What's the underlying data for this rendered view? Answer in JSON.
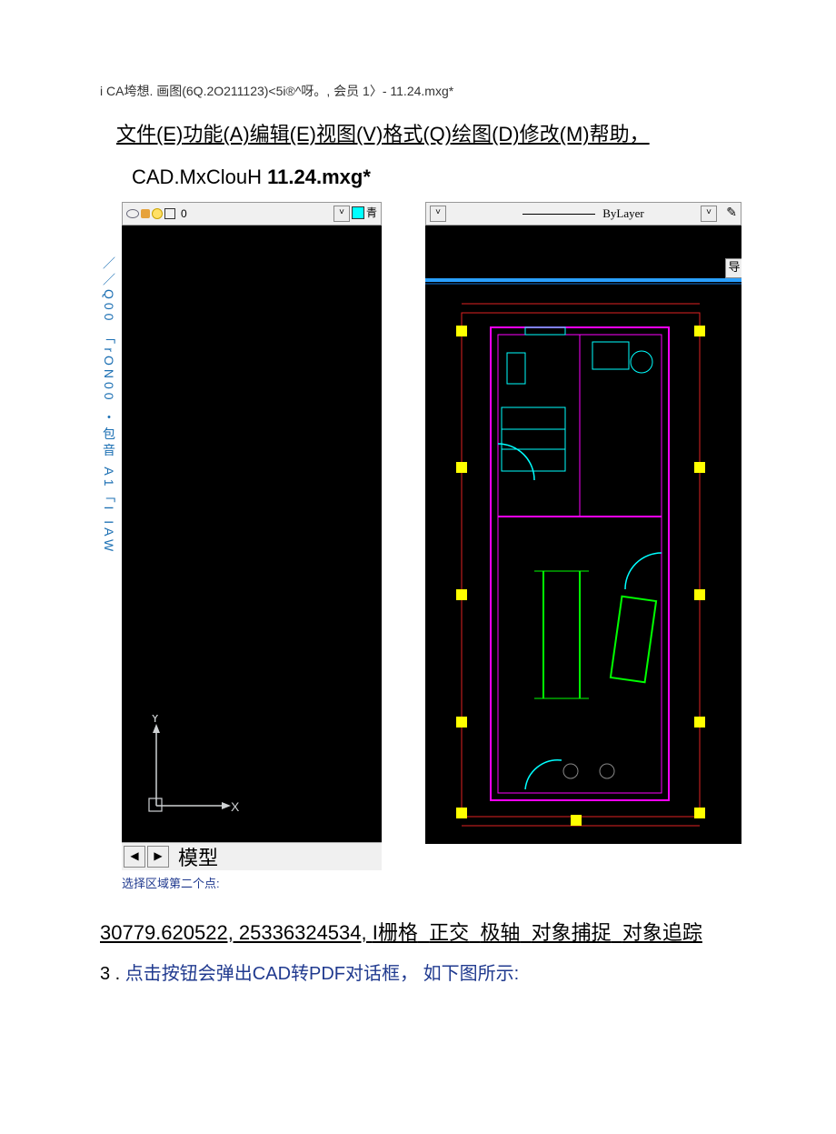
{
  "topTitle": "i CA垮想. 画图(6Q.2O211123)<5i®^呀。, 会员 1〉- 11.24.mxg*",
  "menu": {
    "file": "文件(E)",
    "feature": "功能(A)",
    "edit": "编辑(E)",
    "view": "视图(V)",
    "format": "格式(Q)",
    "draw": "绘图(D)",
    "modify": "修改(M)",
    "help": "帮助，"
  },
  "fileTitlePrefix": "CAD.MxClouH ",
  "fileTitleBold": "11.24.mxg*",
  "leftToolbar": {
    "layerDigit": "0",
    "colorLabel": "青"
  },
  "verticalText": "／／Q00 「rON00 ・包音 A1「I IAW",
  "ucs": {
    "x": "X",
    "y": "Y"
  },
  "tabs": {
    "active": "模型",
    "prev": "◀",
    "next": "▶"
  },
  "prompt": "选择区域第二个点:",
  "rightToolbar": {
    "lineType": "ByLayer",
    "tagBtn": "导"
  },
  "statusBar": {
    "coords": "30779.620522, 25336324534, ",
    "grid": "I栅格",
    "ortho": "正交",
    "polar": "极轴",
    "osnap": "对象捕捉",
    "otrack": "对象追踪"
  },
  "info": {
    "num": "3 . ",
    "text": "点击按钮会弹出CAD转PDF对话框， 如下图所示:"
  }
}
